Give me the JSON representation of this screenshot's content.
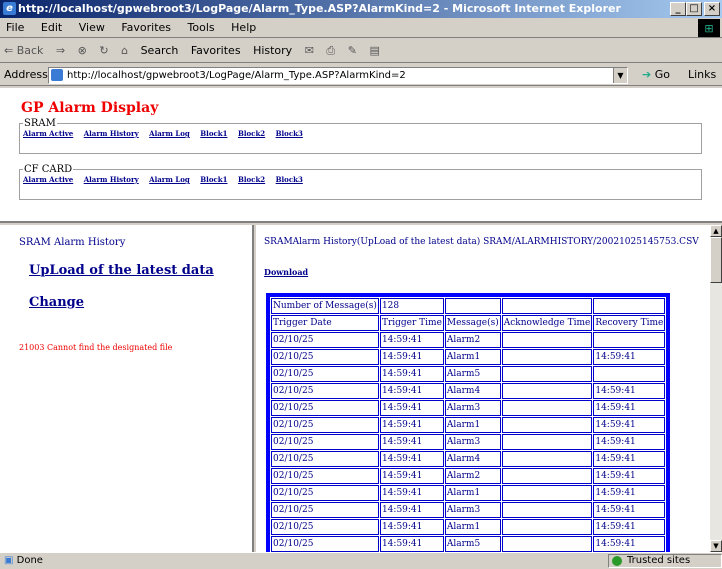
{
  "window": {
    "title": "http://localhost/gpwebroot3/LogPage/Alarm_Type.ASP?AlarmKind=2 - Microsoft Internet Explorer"
  },
  "menu": [
    "File",
    "Edit",
    "View",
    "Favorites",
    "Tools",
    "Help"
  ],
  "toolbar": {
    "back": "⇐ Back",
    "forward": "⇒",
    "stop": "⊗",
    "refresh": "↻",
    "home": "⌂",
    "search": "Search",
    "favorites": "Favorites",
    "history": "History",
    "mail": "✉",
    "print": "⎙",
    "edit": "✎",
    "discuss": "▤"
  },
  "address": {
    "label": "Address",
    "url": "http://localhost/gpwebroot3/LogPage/Alarm_Type.ASP?AlarmKind=2",
    "go": "Go",
    "links": "Links"
  },
  "top": {
    "title": "GP Alarm Display",
    "sram": {
      "legend": "SRAM",
      "links": [
        "Alarm Active",
        "Alarm History",
        "Alarm Log",
        "Block1",
        "Block2",
        "Block3"
      ]
    },
    "cf": {
      "legend": "CF CARD",
      "links": [
        "Alarm Active",
        "Alarm History",
        "Alarm Log",
        "Block1",
        "Block2",
        "Block3"
      ]
    }
  },
  "left": {
    "heading": "SRAM Alarm History",
    "upload_link": "UpLoad of the latest data",
    "change_link": "Change",
    "error": "21003 Cannot find the designated file"
  },
  "right": {
    "heading": "SRAMAlarm History(UpLoad of the latest data) SRAM/ALARMHISTORY/20021025145753.CSV",
    "download": "Download",
    "count_label": "Number of Message(s)",
    "count_value": "128",
    "headers": [
      "Trigger Date",
      "Trigger Time",
      "Message(s)",
      "Acknowledge Time",
      "Recovery Time"
    ],
    "rows": [
      [
        "02/10/25",
        "14:59:41",
        "Alarm2",
        "",
        ""
      ],
      [
        "02/10/25",
        "14:59:41",
        "Alarm1",
        "",
        "14:59:41"
      ],
      [
        "02/10/25",
        "14:59:41",
        "Alarm5",
        "",
        ""
      ],
      [
        "02/10/25",
        "14:59:41",
        "Alarm4",
        "",
        "14:59:41"
      ],
      [
        "02/10/25",
        "14:59:41",
        "Alarm3",
        "",
        "14:59:41"
      ],
      [
        "02/10/25",
        "14:59:41",
        "Alarm1",
        "",
        "14:59:41"
      ],
      [
        "02/10/25",
        "14:59:41",
        "Alarm3",
        "",
        "14:59:41"
      ],
      [
        "02/10/25",
        "14:59:41",
        "Alarm4",
        "",
        "14:59:41"
      ],
      [
        "02/10/25",
        "14:59:41",
        "Alarm2",
        "",
        "14:59:41"
      ],
      [
        "02/10/25",
        "14:59:41",
        "Alarm1",
        "",
        "14:59:41"
      ],
      [
        "02/10/25",
        "14:59:41",
        "Alarm3",
        "",
        "14:59:41"
      ],
      [
        "02/10/25",
        "14:59:41",
        "Alarm1",
        "",
        "14:59:41"
      ],
      [
        "02/10/25",
        "14:59:41",
        "Alarm5",
        "",
        "14:59:41"
      ]
    ]
  },
  "status": {
    "text": "Done",
    "zone": "Trusted sites"
  }
}
